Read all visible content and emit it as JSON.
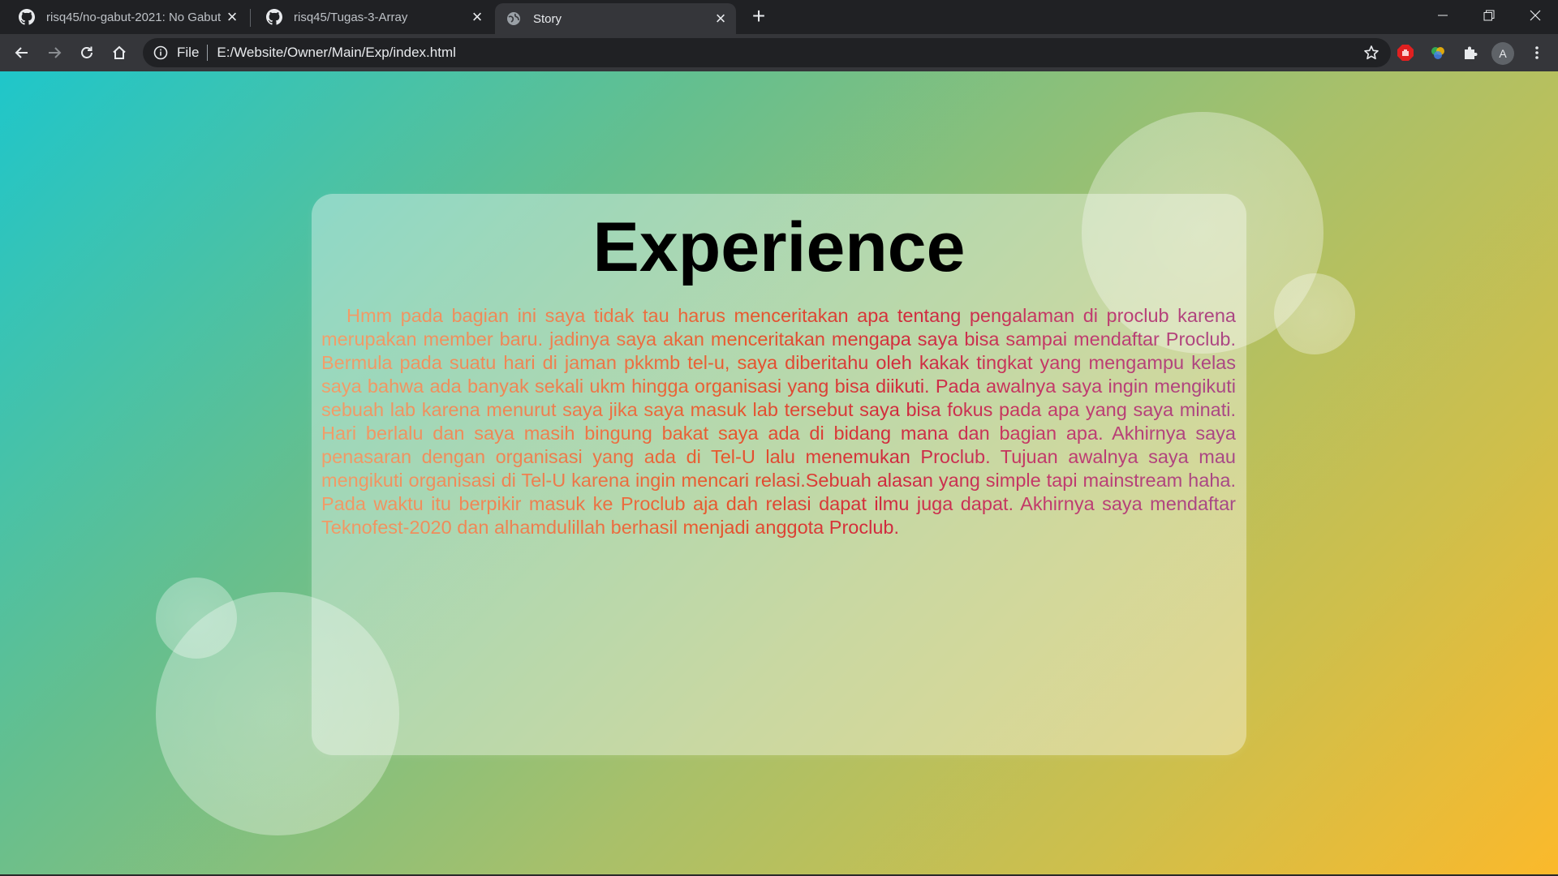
{
  "browser": {
    "tabs": [
      {
        "title": "risq45/no-gabut-2021: No Gabut",
        "icon": "github-icon",
        "active": false
      },
      {
        "title": "risq45/Tugas-3-Array",
        "icon": "github-icon",
        "active": false
      },
      {
        "title": "Story",
        "icon": "globe-icon",
        "active": true
      }
    ],
    "address_bar": {
      "scheme_label": "File",
      "url": "E:/Website/Owner/Main/Exp/index.html"
    },
    "profile_initial": "A"
  },
  "page": {
    "heading": "Experience",
    "story": "Hmm pada bagian ini saya tidak tau harus menceritakan apa tentang pengalaman di proclub karena merupakan member baru. jadinya saya akan menceritakan mengapa saya bisa sampai mendaftar Proclub. Bermula pada suatu hari di jaman pkkmb tel-u, saya diberitahu oleh kakak tingkat yang mengampu kelas saya bahwa ada banyak sekali ukm hingga organisasi yang bisa diikuti. Pada awalnya saya ingin mengikuti sebuah lab karena menurut saya jika saya masuk lab tersebut saya bisa fokus pada apa yang saya minati. Hari berlalu dan saya masih bingung bakat saya ada di bidang mana dan bagian apa. Akhirnya saya penasaran dengan organisasi yang ada di Tel-U lalu menemukan Proclub. Tujuan awalnya saya mau mengikuti organisasi di Tel-U karena ingin mencari relasi.Sebuah alasan yang simple tapi mainstream haha. Pada waktu itu berpikir masuk ke Proclub aja dah relasi dapat ilmu juga dapat. Akhirnya saya mendaftar Teknofest-2020 dan alhamdulillah berhasil menjadi anggota Proclub."
  },
  "colors": {
    "gradient_start": "#1fc6ca",
    "gradient_end": "#fbb92b",
    "text_gradient_start": "#f2a06b",
    "text_gradient_end": "#a44a8a"
  }
}
